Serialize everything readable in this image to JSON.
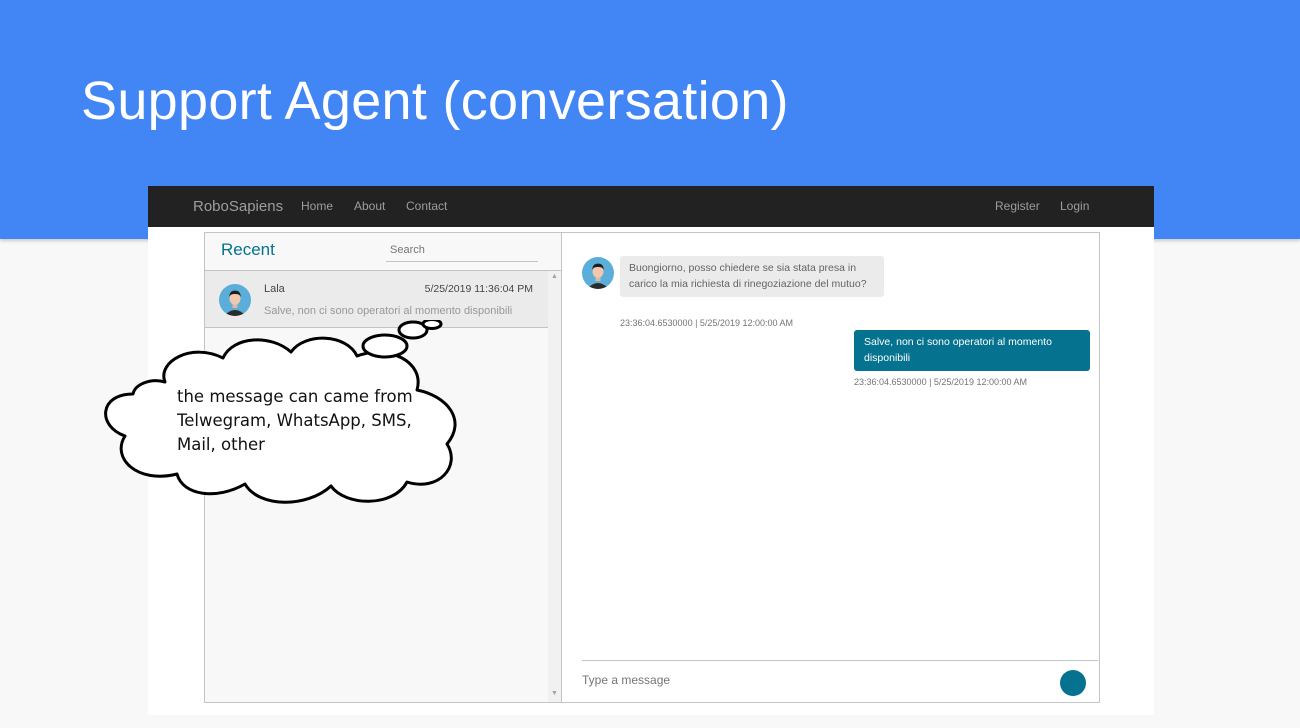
{
  "slide": {
    "title": "Support Agent (conversation)"
  },
  "navbar": {
    "brand": "RoboSapiens",
    "links": [
      "Home",
      "About",
      "Contact"
    ],
    "right_links": [
      "Register",
      "Login"
    ]
  },
  "inbox": {
    "heading": "Recent",
    "search_placeholder": "Search",
    "chats": [
      {
        "name": "Lala",
        "date": "5/25/2019 11:36:04 PM",
        "preview": "Salve, non ci sono operatori al momento disponibili"
      }
    ]
  },
  "conversation": {
    "messages": [
      {
        "direction": "incoming",
        "text": "Buongiorno, posso chiedere se sia stata presa in carico la mia richiesta di rinegoziazione del mutuo?",
        "time": "23:36:04.6530000 | 5/25/2019 12:00:00 AM"
      },
      {
        "direction": "outgoing",
        "text": "Salve, non ci sono operatori al momento disponibili",
        "time": "23:36:04.6530000 | 5/25/2019 12:00:00 AM"
      }
    ],
    "input_placeholder": "Type a message"
  },
  "callout": {
    "lines": [
      "the message can came from",
      "Telwegram, WhatsApp, SMS,",
      "Mail, other"
    ]
  },
  "colors": {
    "header_blue": "#4285f4",
    "navbar_bg": "#222222",
    "accent_teal": "#05728f",
    "incoming_bubble": "#ebebeb",
    "avatar_bg": "#5aaed9"
  }
}
